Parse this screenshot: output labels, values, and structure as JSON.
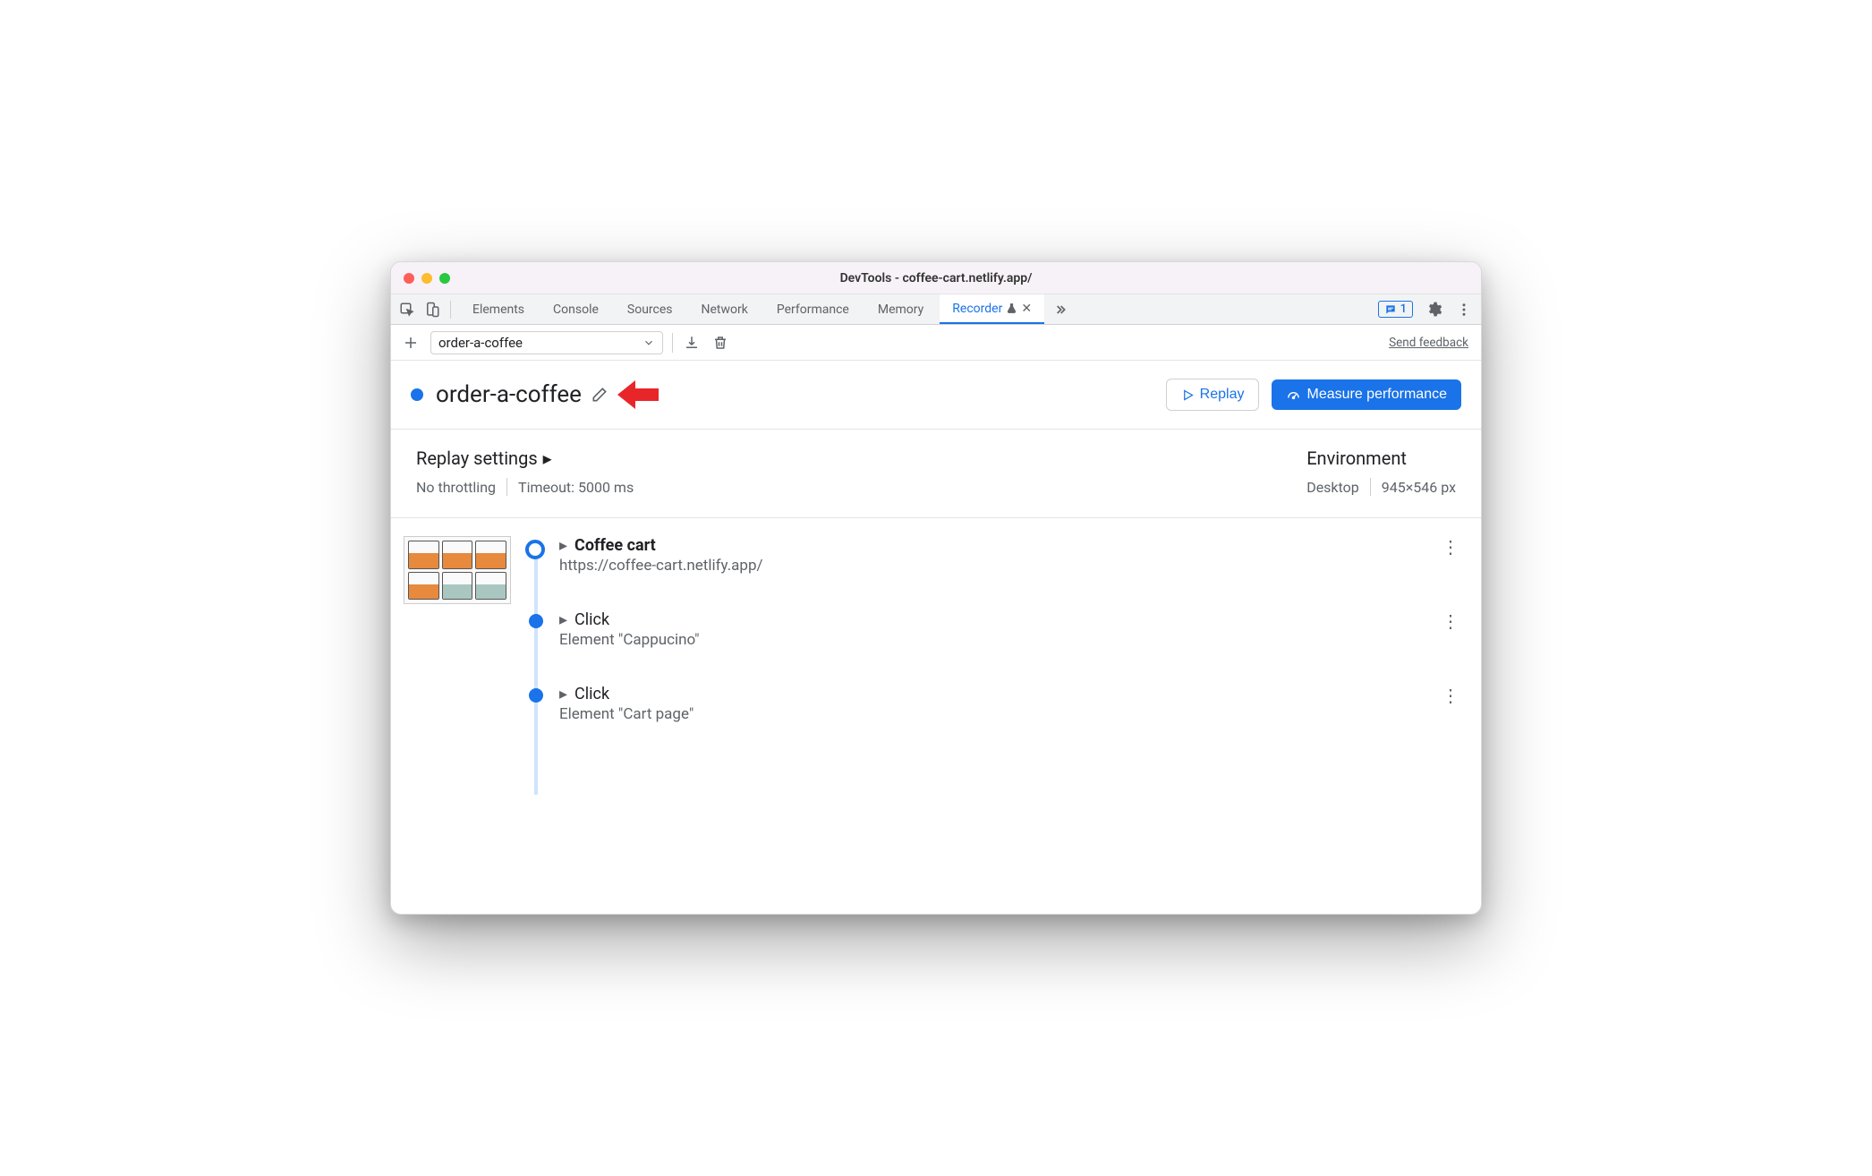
{
  "window": {
    "title": "DevTools - coffee-cart.netlify.app/"
  },
  "tabs": {
    "elements": "Elements",
    "console": "Console",
    "sources": "Sources",
    "network": "Network",
    "performance": "Performance",
    "memory": "Memory",
    "recorder": "Recorder",
    "issues_count": "1"
  },
  "toolbar": {
    "recording_name": "order-a-coffee",
    "send_feedback": "Send feedback"
  },
  "header": {
    "title": "order-a-coffee",
    "replay": "Replay",
    "measure": "Measure performance"
  },
  "settings": {
    "replay_title": "Replay settings",
    "throttling": "No throttling",
    "timeout": "Timeout: 5000 ms",
    "env_title": "Environment",
    "env_device": "Desktop",
    "env_viewport": "945×546 px"
  },
  "steps": [
    {
      "title": "Coffee cart",
      "sub": "https://coffee-cart.netlify.app/",
      "first": true
    },
    {
      "title": "Click",
      "sub": "Element \"Cappucino\"",
      "first": false
    },
    {
      "title": "Click",
      "sub": "Element \"Cart page\"",
      "first": false
    }
  ]
}
